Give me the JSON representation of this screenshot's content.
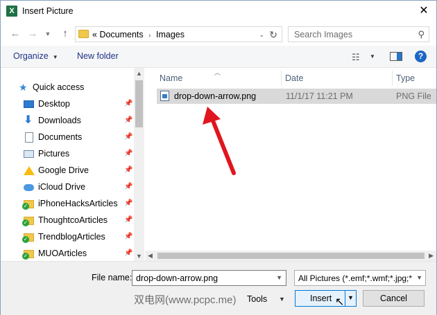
{
  "window": {
    "title": "Insert Picture",
    "app_icon": "excel-icon"
  },
  "address": {
    "crumb_prefix": "«",
    "crumbs": [
      "Documents",
      "Images"
    ],
    "separator": "›"
  },
  "search": {
    "placeholder": "Search Images"
  },
  "toolbar": {
    "organize_label": "Organize",
    "new_folder_label": "New folder"
  },
  "nav": {
    "quick_access": "Quick access",
    "items": [
      {
        "label": "Desktop",
        "icon": "desktop-icon"
      },
      {
        "label": "Downloads",
        "icon": "downloads-icon"
      },
      {
        "label": "Documents",
        "icon": "documents-icon"
      },
      {
        "label": "Pictures",
        "icon": "pictures-icon"
      },
      {
        "label": "Google Drive",
        "icon": "google-drive-icon"
      },
      {
        "label": "iCloud Drive",
        "icon": "icloud-icon"
      },
      {
        "label": "iPhoneHacksArticles",
        "icon": "synced-folder-icon"
      },
      {
        "label": "ThoughtcoArticles",
        "icon": "synced-folder-icon"
      },
      {
        "label": "TrendblogArticles",
        "icon": "synced-folder-icon"
      },
      {
        "label": "MUOArticles",
        "icon": "synced-folder-icon"
      }
    ]
  },
  "columns": {
    "name": "Name",
    "date": "Date",
    "type": "Type"
  },
  "files": [
    {
      "name": "drop-down-arrow.png",
      "date": "11/1/17 11:21 PM",
      "type": "PNG File"
    }
  ],
  "bottom": {
    "file_name_label": "File name:",
    "file_name_value": "drop-down-arrow.png",
    "filter_value": "All Pictures (*.emf;*.wmf;*.jpg;*",
    "tools_label": "Tools",
    "insert_label": "Insert",
    "cancel_label": "Cancel"
  },
  "watermark": "双电网(www.pcpc.me)",
  "colors": {
    "accent": "#0078d7",
    "annotation_arrow": "#e0161e",
    "selection": "#d9d9d9"
  }
}
